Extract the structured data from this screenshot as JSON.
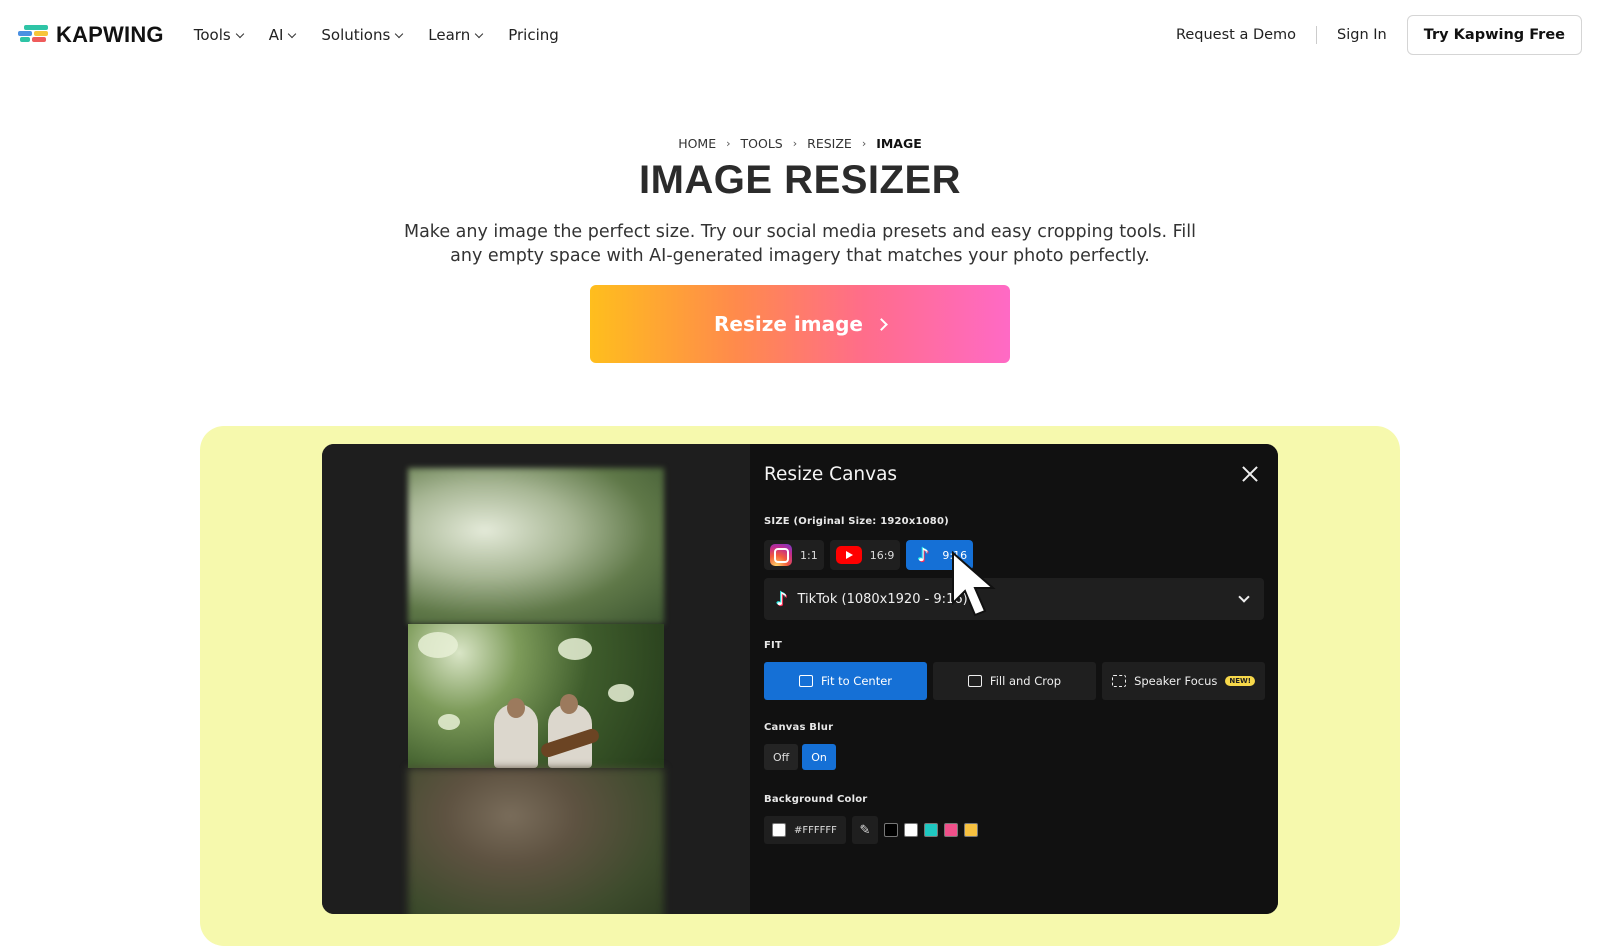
{
  "brand": {
    "name": "KAPWING",
    "logo_colors": [
      "#2ec4a6",
      "#f7c53a",
      "#ef5b5b",
      "#4a90e2"
    ]
  },
  "nav": [
    {
      "label": "Tools",
      "dropdown": true
    },
    {
      "label": "AI",
      "dropdown": true
    },
    {
      "label": "Solutions",
      "dropdown": true
    },
    {
      "label": "Learn",
      "dropdown": true
    },
    {
      "label": "Pricing",
      "dropdown": false
    }
  ],
  "header_right": {
    "demo": "Request a Demo",
    "signin": "Sign In",
    "try": "Try Kapwing Free"
  },
  "breadcrumb": [
    "HOME",
    "TOOLS",
    "RESIZE",
    "IMAGE"
  ],
  "hero": {
    "title": "IMAGE RESIZER",
    "subtitle": "Make any image the perfect size. Try our social media presets and easy cropping tools. Fill any empty space with AI-generated imagery that matches your photo perfectly.",
    "cta": "Resize image"
  },
  "demo": {
    "bg_color": "#f6f9ad",
    "panel": {
      "title": "Resize Canvas",
      "size_label": "SIZE (Original Size: 1920x1080)",
      "presets": [
        {
          "icon": "instagram-icon",
          "label": "1:1",
          "active": false
        },
        {
          "icon": "youtube-icon",
          "label": "16:9",
          "active": false
        },
        {
          "icon": "tiktok-icon",
          "label": "9:16",
          "active": true
        }
      ],
      "selected_preset": "TikTok (1080x1920 - 9:16)",
      "fit_label": "FIT",
      "fit_options": [
        {
          "label": "Fit to Center",
          "active": true
        },
        {
          "label": "Fill and Crop",
          "active": false
        },
        {
          "label": "Speaker Focus",
          "badge": "NEW!",
          "active": false
        }
      ],
      "blur_label": "Canvas Blur",
      "blur_options": [
        {
          "label": "Off",
          "active": false
        },
        {
          "label": "On",
          "active": true
        }
      ],
      "bg_color_label": "Background Color",
      "bg_color_value": "#FFFFFF",
      "swatches": [
        "#000000",
        "#ffffff",
        "#1fc8c1",
        "#f0508a",
        "#f7c140"
      ]
    }
  }
}
